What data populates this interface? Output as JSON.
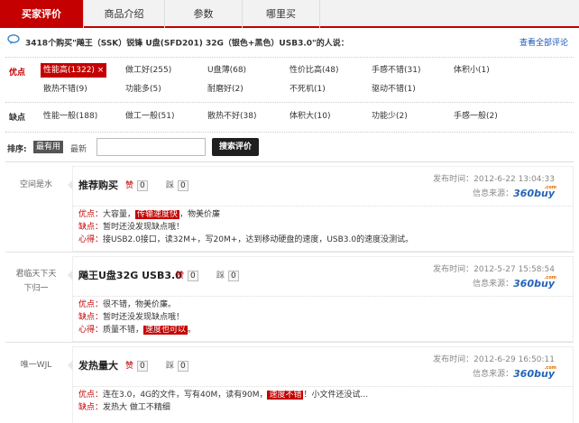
{
  "tabs": [
    "买家评价",
    "商品介绍",
    "参数",
    "哪里买"
  ],
  "summary": {
    "count": "3418",
    "text": "个购买\"飚王（SSK）锐锋 U盘(SFD201) 32G（银色+黑色）USB3.0\"的人说：",
    "view_all": "查看全部评论"
  },
  "good_label": "优点",
  "bad_label": "缺点",
  "good_tags": [
    "性能高(1322)",
    "做工好(255)",
    "U盘薄(68)",
    "性价比高(48)",
    "手感不错(31)",
    "体积小(1)",
    "散热不错(9)",
    "功能多(5)",
    "耐磨好(2)",
    "不死机(1)",
    "驱动不错(1)"
  ],
  "bad_tags": [
    "性能一般(188)",
    "做工一般(51)",
    "散热不好(38)",
    "体积大(10)",
    "功能少(2)",
    "手感一般(2)"
  ],
  "sort": {
    "label": "排序:",
    "hot": "最有用",
    "new": "最新",
    "search_button": "搜索评价"
  },
  "labels": {
    "pros": "优点：",
    "cons": "缺点：",
    "exp": "心得：",
    "time": "发布时间：",
    "source": "信息来源：",
    "up": "赞",
    "down": "踩"
  },
  "source_logo": "360buy",
  "source_logo_sup": ".com",
  "reviews": [
    {
      "user": "空间是水",
      "title": "推荐购买",
      "up": "0",
      "down": "0",
      "time": "2012-6-22 13:04:33",
      "pros_a": "大容量，",
      "pros_hl": "传输速度快",
      "pros_b": "，物美价廉",
      "cons": "暂时还没发现缺点哦！",
      "exp_a": "接USB2.0接口，读32M+，写20M+，达到移动硬盘的速度，USB3.0的速度没测试。",
      "exp_hl": "",
      "exp_b": ""
    },
    {
      "user": "君临天下天下归一",
      "user_l1": "君临天下天",
      "user_l2": "下归一",
      "title": "飚王U盘32G USB3.0",
      "up": "0",
      "down": "0",
      "time": "2012-5-27 15:58:54",
      "pros_a": "很不错，物美价廉。",
      "pros_hl": "",
      "pros_b": "",
      "cons": "暂时还没发现缺点哦！",
      "exp_a": "质量不错，",
      "exp_hl": "速度也可以",
      "exp_b": "。"
    },
    {
      "user": "唯一WJL",
      "title": "发热量大",
      "up": "0",
      "down": "0",
      "time": "2012-6-29 16:50:11",
      "pros_a": "连在3.0，4G的文件，写有40M，读有90M，",
      "pros_hl": "速度不错",
      "pros_b": "！小文件还没试...",
      "cons": "发热大 做工不精细"
    }
  ],
  "colors": {
    "accent": "#c40000",
    "link": "#1a56b8"
  }
}
